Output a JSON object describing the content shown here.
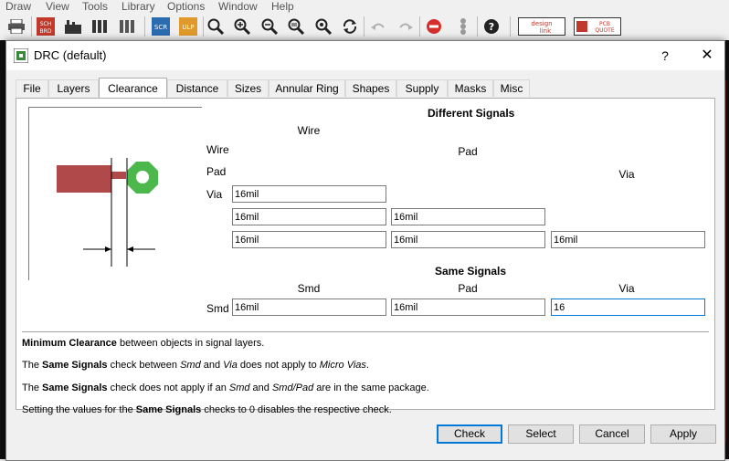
{
  "menubar": [
    "Draw",
    "View",
    "Tools",
    "Library",
    "Options",
    "Window",
    "Help"
  ],
  "toolbar": {
    "sch_label": "SCH\nBRD",
    "designlink_label": "design link",
    "pcbquote_label": "PCB QUOTE"
  },
  "dialog": {
    "title": "DRC (default)",
    "help": "?",
    "close": "✕"
  },
  "tabs": [
    "File",
    "Layers",
    "Clearance",
    "Distance",
    "Sizes",
    "Annular Ring",
    "Shapes",
    "Supply",
    "Masks",
    "Misc"
  ],
  "active_tab": "Clearance",
  "clearance": {
    "different_signals_header": "Different Signals",
    "same_signals_header": "Same Signals",
    "col_wire": "Wire",
    "col_pad": "Pad",
    "col_via": "Via",
    "row_wire": "Wire",
    "row_pad": "Pad",
    "row_via": "Via",
    "wire_wire": "16mil",
    "pad_wire": "16mil",
    "pad_pad": "16mil",
    "via_wire": "16mil",
    "via_pad": "16mil",
    "via_via": "16mil",
    "same_col_smd": "Smd",
    "same_col_pad": "Pad",
    "same_col_via": "Via",
    "same_row_smd": "Smd",
    "smd_smd": "16mil",
    "smd_pad": "16mil",
    "smd_via": "16"
  },
  "info": {
    "line1_bold": "Minimum Clearance",
    "line1_rest": " between objects in signal layers.",
    "line2_a": "The ",
    "line2_b": "Same Signals",
    "line2_c": " check between ",
    "line2_d": "Smd",
    "line2_e": " and ",
    "line2_f": "Via",
    "line2_g": " does not apply to ",
    "line2_h": "Micro Vias",
    "line2_i": ".",
    "line3_a": "The ",
    "line3_b": "Same Signals",
    "line3_c": " check does not apply if an ",
    "line3_d": "Smd",
    "line3_e": " and ",
    "line3_f": "Smd/Pad",
    "line3_g": " are in the same package.",
    "line4_a": "Setting the values for the ",
    "line4_b": "Same Signals",
    "line4_c": " checks to 0 disables the respective check."
  },
  "buttons": {
    "check": "Check",
    "select": "Select",
    "cancel": "Cancel",
    "apply": "Apply"
  },
  "colors": {
    "wire": "#b04a4a",
    "via": "#4cb84c",
    "focus": "#0078d7"
  }
}
